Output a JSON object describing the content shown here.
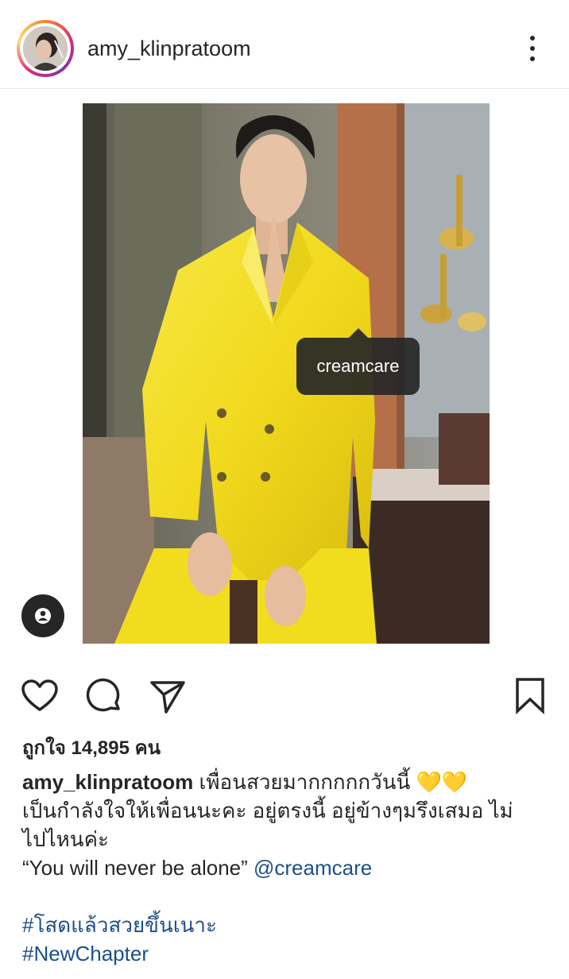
{
  "post": {
    "username": "amy_klinpratoom",
    "photo_tag": "creamcare",
    "likes_text": "ถูกใจ 14,895 คน",
    "caption": {
      "username": "amy_klinpratoom",
      "line1_text": "เพื่อนสวยมากกกกกวันนี้",
      "emoji": "💛💛",
      "line2": "เป็นกำลังใจให้เพื่อนนะคะ อยู่ตรงนี้ อยู่ข้างๆมรึงเสมอ ไม่",
      "line3": "ไปไหนค่ะ",
      "quote": "“You will never be alone”",
      "mention": "@creamcare",
      "hashtag1": "#โสดแล้วสวยขึ้นเนาะ",
      "hashtag2": "#NewChapter"
    }
  },
  "icons": {
    "more": "more-vertical-icon",
    "like": "heart-outline-icon",
    "comment": "comment-icon",
    "share": "send-icon",
    "save": "bookmark-icon",
    "tags": "user-tag-icon"
  },
  "colors": {
    "text": "#262626",
    "link": "#1c4f8a",
    "suit": "#f2dc1e"
  }
}
